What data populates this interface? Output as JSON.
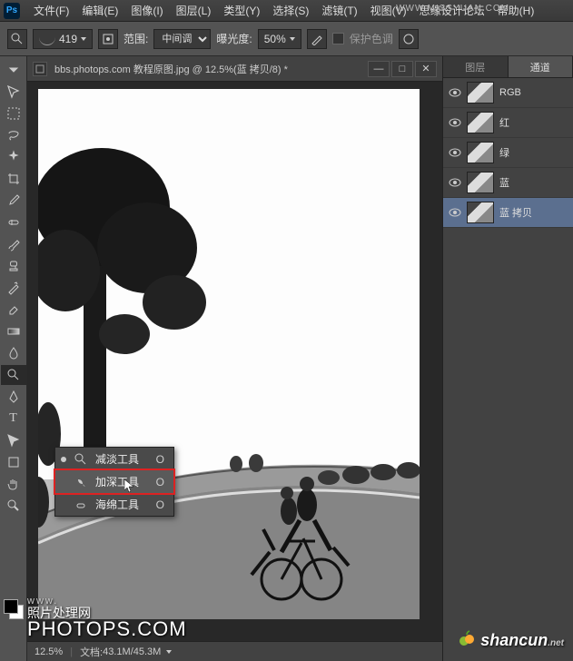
{
  "menu": [
    "文件(F)",
    "编辑(E)",
    "图像(I)",
    "图层(L)",
    "类型(Y)",
    "选择(S)",
    "滤镜(T)",
    "视图(V)",
    "思缘设计论坛",
    "帮助(H)"
  ],
  "url_top": "WWW.MISSYUAN.COM",
  "options": {
    "brush_size": "419",
    "range_label": "范围:",
    "range_value": "中间调",
    "exposure_label": "曝光度:",
    "exposure_value": "50%",
    "protect_label": "保护色调"
  },
  "tab_title": "bbs.photops.com  教程原图.jpg @ 12.5%(蓝 拷贝/8) *",
  "flyout": [
    {
      "label": "减淡工具",
      "key": "O",
      "dot": true
    },
    {
      "label": "加深工具",
      "key": "O",
      "dot": false,
      "hl": true
    },
    {
      "label": "海绵工具",
      "key": "O",
      "dot": false
    }
  ],
  "panels": {
    "tabs": [
      "图层",
      "通道"
    ]
  },
  "channels": [
    {
      "name": "RGB",
      "eye": true
    },
    {
      "name": "红",
      "eye": true
    },
    {
      "name": "绿",
      "eye": true
    },
    {
      "name": "蓝",
      "eye": true
    },
    {
      "name": "蓝 拷贝",
      "eye": true,
      "sel": true
    }
  ],
  "status": {
    "zoom": "12.5%",
    "doc_label": "文档:",
    "doc_value": "43.1M/45.3M"
  },
  "wm1_small": "www.",
  "wm1_sub": "照片处理网",
  "wm1_main": "PHOTOPS.COM",
  "wm2": "shancun",
  "wm2_sub": ".net"
}
